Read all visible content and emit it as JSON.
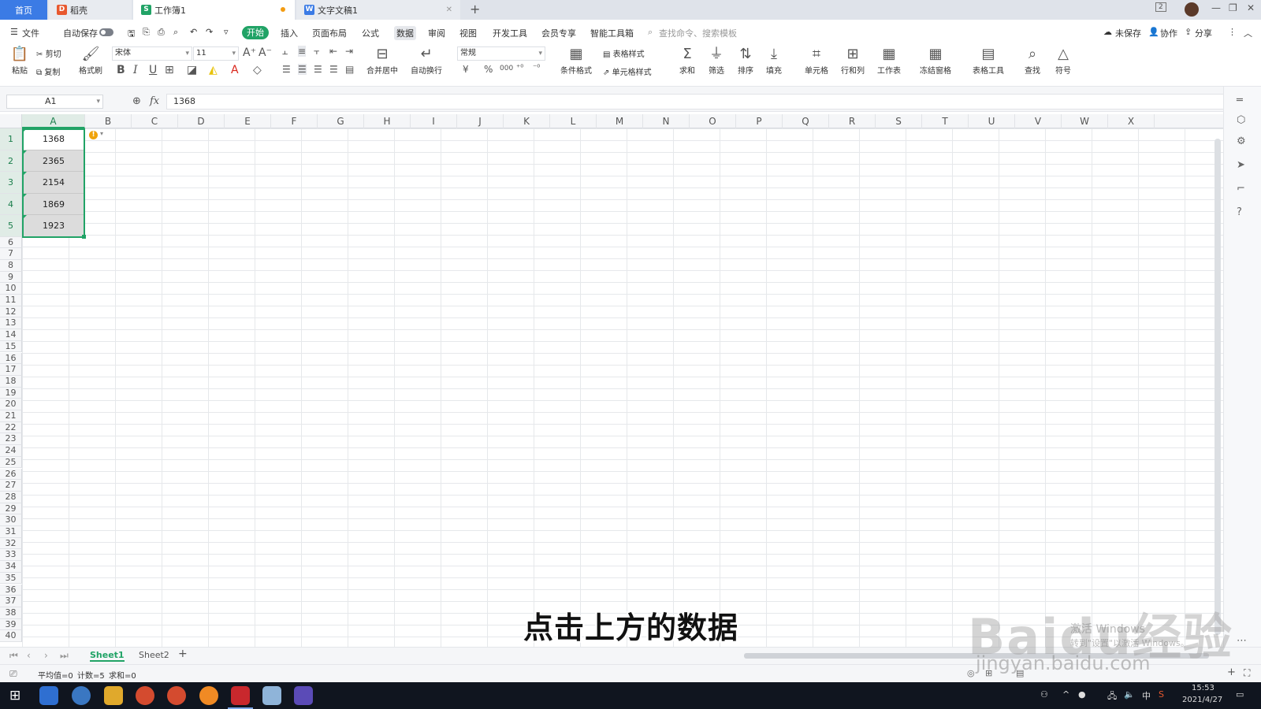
{
  "titlebar": {
    "tabs": [
      {
        "label": "首页"
      },
      {
        "label": "稻壳"
      },
      {
        "label": "工作簿1"
      },
      {
        "label": "文字文稿1"
      }
    ],
    "window_badge": "2"
  },
  "menu": {
    "file": "文件",
    "autosave": "自动保存",
    "items": [
      "开始",
      "插入",
      "页面布局",
      "公式",
      "数据",
      "审阅",
      "视图",
      "开发工具",
      "会员专享",
      "智能工具箱"
    ],
    "search_placeholder": "查找命令、搜索模板",
    "unsaved": "未保存",
    "collab": "协作",
    "share": "分享"
  },
  "ribbon": {
    "paste": "粘贴",
    "cut": "剪切",
    "copy": "复制",
    "format_painter": "格式刷",
    "font": "宋体",
    "size": "11",
    "merge": "合并居中",
    "wrap": "自动换行",
    "number_format": "常规",
    "table_style": "表格样式",
    "cond_format": "条件格式",
    "cell_style": "单元格样式",
    "sum": "求和",
    "filter": "筛选",
    "sort": "排序",
    "fill": "填充",
    "cell": "单元格",
    "rowcol": "行和列",
    "worksheet": "工作表",
    "freeze": "冻结窗格",
    "table_tools": "表格工具",
    "find": "查找",
    "symbol": "符号",
    "currency": "¥",
    "percent": "%",
    "thousands": "000"
  },
  "formula_bar": {
    "name_box": "A1",
    "fx": "fx",
    "value": "1368"
  },
  "columns": [
    "A",
    "B",
    "C",
    "D",
    "E",
    "F",
    "G",
    "H",
    "I",
    "J",
    "K",
    "L",
    "M",
    "N",
    "O",
    "P",
    "Q",
    "R",
    "S",
    "T",
    "U",
    "V",
    "W",
    "X"
  ],
  "rows": [
    "1",
    "2",
    "3",
    "4",
    "5",
    "6",
    "7",
    "8",
    "9",
    "10",
    "11",
    "12",
    "13",
    "14",
    "15",
    "16",
    "17",
    "18",
    "19",
    "20",
    "21",
    "22",
    "23",
    "24",
    "25",
    "26",
    "27",
    "28",
    "29",
    "30",
    "31",
    "32",
    "33",
    "34",
    "35",
    "36",
    "37",
    "38",
    "39",
    "40"
  ],
  "cells_A": [
    "1368",
    "2365",
    "2154",
    "1869",
    "1923"
  ],
  "sheets": {
    "tabs": [
      "Sheet1",
      "Sheet2"
    ],
    "active": "Sheet1"
  },
  "status": {
    "avg": "平均值=0",
    "count": "计数=5",
    "sum": "求和=0"
  },
  "taskbar": {
    "time": "15:53",
    "date": "2021/4/27",
    "ime": "中"
  },
  "caption": "点击上方的数据",
  "watermark": {
    "brand": "Baidu经验",
    "url": "jingyan.baidu.com",
    "activate": "激活 Windows",
    "activate_sub": "转到\"设置\"以激活 Windows。"
  },
  "colors": {
    "accent": "#21a366",
    "tab_home": "#3b7be5",
    "taskbar": "#10151f"
  }
}
